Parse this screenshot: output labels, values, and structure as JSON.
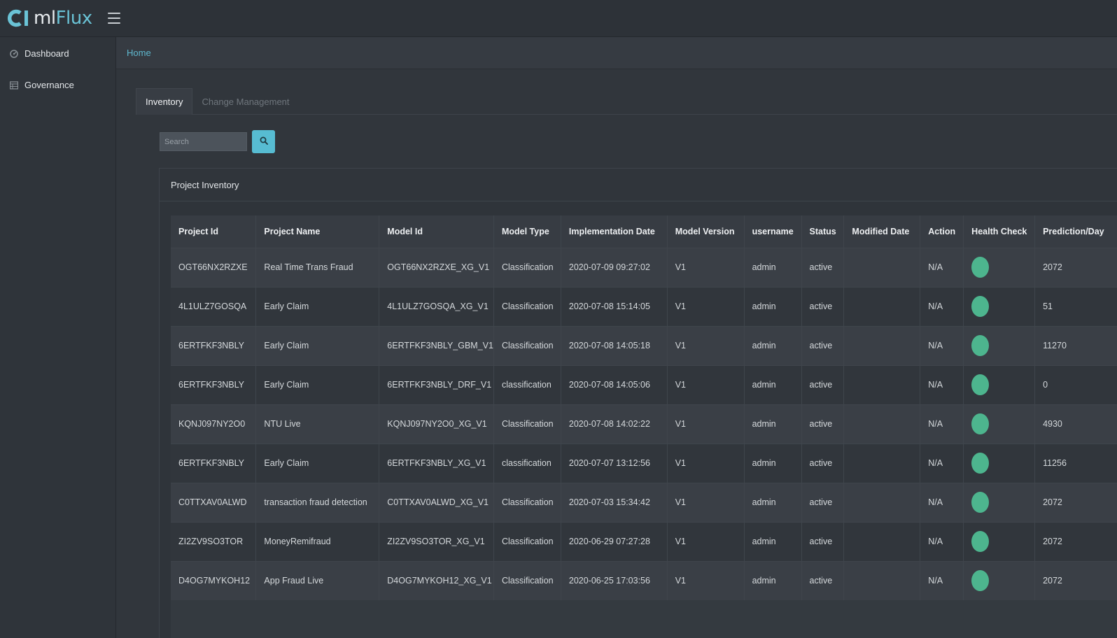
{
  "app": {
    "name_part1": "ml",
    "name_part2": "Flux",
    "accent_color": "#57bcd2",
    "health_ok_color": "#4db58e"
  },
  "sidebar": {
    "items": [
      {
        "label": "Dashboard",
        "icon": "dashboard-icon"
      },
      {
        "label": "Governance",
        "icon": "governance-icon"
      }
    ]
  },
  "breadcrumb": {
    "home": "Home"
  },
  "tabs": [
    {
      "label": "Inventory",
      "active": true
    },
    {
      "label": "Change Management",
      "active": false
    }
  ],
  "search": {
    "placeholder": "Search",
    "value": "",
    "icon": "search-icon"
  },
  "panel": {
    "title": "Project Inventory"
  },
  "table": {
    "columns": [
      "Project Id",
      "Project Name",
      "Model Id",
      "Model Type",
      "Implementation Date",
      "Model Version",
      "username",
      "Status",
      "Modified Date",
      "Action",
      "Health Check",
      "Prediction/Day"
    ],
    "rows": [
      [
        "OGT66NX2RZXE",
        "Real Time Trans Fraud",
        "OGT66NX2RZXE_XG_V1",
        "Classification",
        "2020-07-09 09:27:02",
        "V1",
        "admin",
        "active",
        "",
        "N/A",
        "green",
        "2072"
      ],
      [
        "4L1ULZ7GOSQA",
        "Early Claim",
        "4L1ULZ7GOSQA_XG_V1",
        "Classification",
        "2020-07-08 15:14:05",
        "V1",
        "admin",
        "active",
        "",
        "N/A",
        "green",
        "51"
      ],
      [
        "6ERTFKF3NBLY",
        "Early Claim",
        "6ERTFKF3NBLY_GBM_V1",
        "Classification",
        "2020-07-08 14:05:18",
        "V1",
        "admin",
        "active",
        "",
        "N/A",
        "green",
        "11270"
      ],
      [
        "6ERTFKF3NBLY",
        "Early Claim",
        "6ERTFKF3NBLY_DRF_V1",
        "classification",
        "2020-07-08 14:05:06",
        "V1",
        "admin",
        "active",
        "",
        "N/A",
        "green",
        "0"
      ],
      [
        "KQNJ097NY2O0",
        "NTU Live",
        "KQNJ097NY2O0_XG_V1",
        "Classification",
        "2020-07-08 14:02:22",
        "V1",
        "admin",
        "active",
        "",
        "N/A",
        "green",
        "4930"
      ],
      [
        "6ERTFKF3NBLY",
        "Early Claim",
        "6ERTFKF3NBLY_XG_V1",
        "classification",
        "2020-07-07 13:12:56",
        "V1",
        "admin",
        "active",
        "",
        "N/A",
        "green",
        "11256"
      ],
      [
        "C0TTXAV0ALWD",
        "transaction fraud detection",
        "C0TTXAV0ALWD_XG_V1",
        "Classification",
        "2020-07-03 15:34:42",
        "V1",
        "admin",
        "active",
        "",
        "N/A",
        "green",
        "2072"
      ],
      [
        "ZI2ZV9SO3TOR",
        "MoneyRemifraud",
        "ZI2ZV9SO3TOR_XG_V1",
        "Classification",
        "2020-06-29 07:27:28",
        "V1",
        "admin",
        "active",
        "",
        "N/A",
        "green",
        "2072"
      ],
      [
        "D4OG7MYKOH12",
        "App Fraud Live",
        "D4OG7MYKOH12_XG_V1",
        "Classification",
        "2020-06-25 17:03:56",
        "V1",
        "admin",
        "active",
        "",
        "N/A",
        "green",
        "2072"
      ]
    ]
  }
}
